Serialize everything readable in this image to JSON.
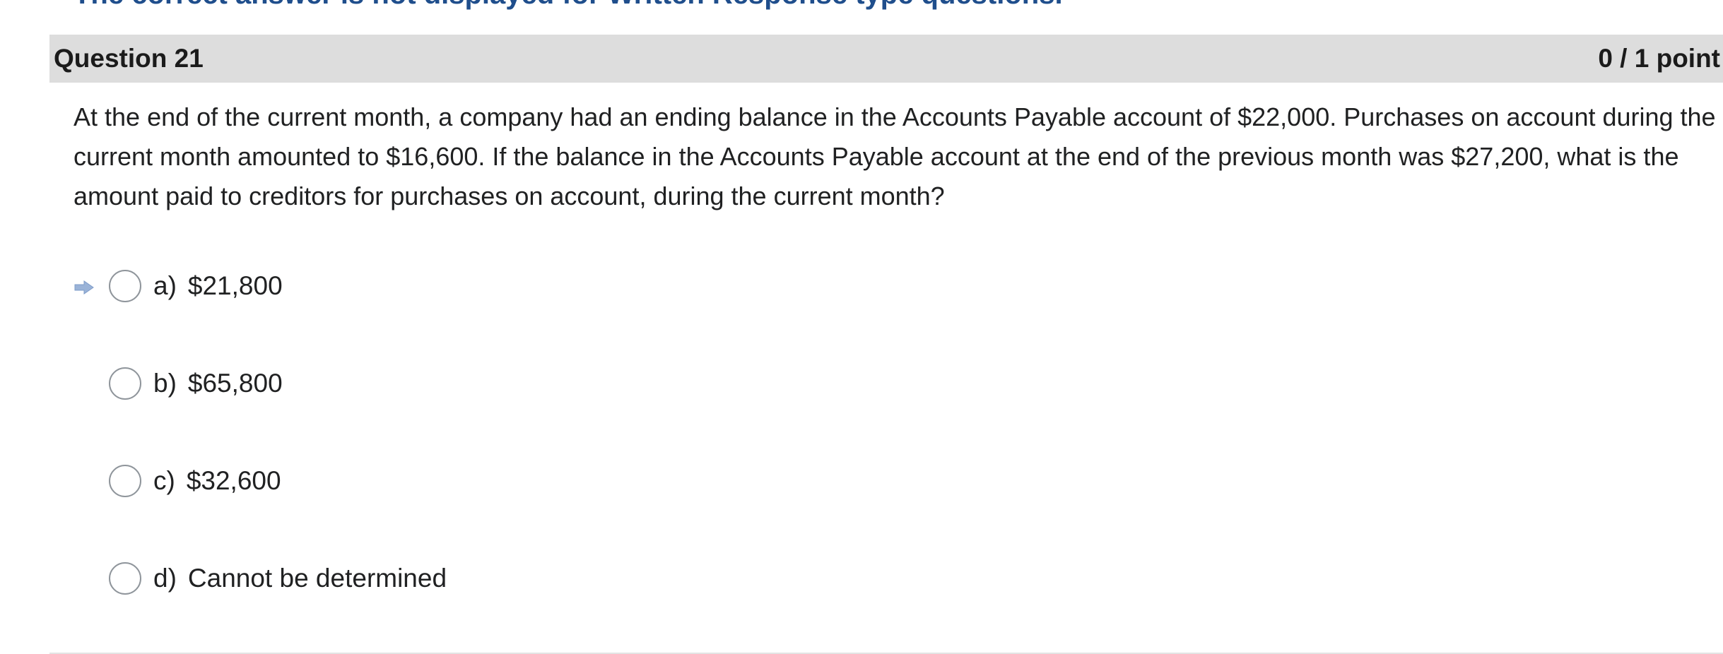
{
  "top_note": "The correct answer is not displayed for Written Response type questions.",
  "question": {
    "title": "Question 21",
    "points": "0 / 1 point",
    "text": "At the end of the current month, a company had an ending balance in the Accounts Payable account of $22,000. Purchases on account during the current month amounted to $16,600. If the balance in the Accounts Payable account at the end of the previous month was $27,200, what is the amount paid to creditors for  purchases on account, during the current month?"
  },
  "choices": [
    {
      "letter": "a)",
      "text": "$21,800",
      "marker": "arrow-right-icon"
    },
    {
      "letter": "b)",
      "text": "$65,800"
    },
    {
      "letter": "c)",
      "text": "$32,600"
    },
    {
      "letter": "d)",
      "text": "Cannot be determined"
    }
  ],
  "colors": {
    "header_bg": "#dddddd",
    "note_text": "#1f4e8c",
    "arrow": "#9ab3d8",
    "radio_border": "#8f959b"
  }
}
